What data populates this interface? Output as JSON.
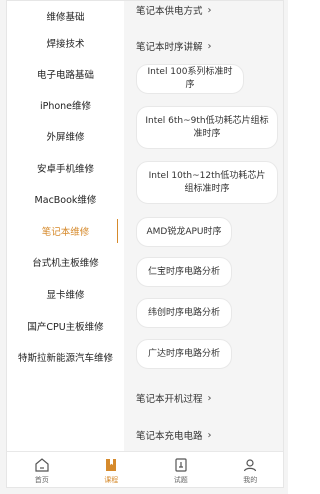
{
  "sidebar": {
    "items": [
      {
        "label": "维修基础"
      },
      {
        "label": "焊接技术"
      },
      {
        "label": "电子电路基础"
      },
      {
        "label": "iPhone维修"
      },
      {
        "label": "外屏维修"
      },
      {
        "label": "安卓手机维修"
      },
      {
        "label": "MacBook维修"
      },
      {
        "label": "笔记本维修"
      },
      {
        "label": "台式机主板维修"
      },
      {
        "label": "显卡维修"
      },
      {
        "label": "国产CPU主板维修"
      },
      {
        "label": "特斯拉新能源汽车维修"
      }
    ],
    "active_index": 7
  },
  "content": {
    "section_power": "笔记本供电方式",
    "section_timing": "笔记本时序讲解",
    "timing_items": [
      "Intel 100系列标准时序",
      "Intel 6th~9th低功耗芯片组标准时序",
      "Intel 10th~12th低功耗芯片组标准时序",
      "AMD锐龙APU时序",
      "仁宝时序电路分析",
      "纬创时序电路分析",
      "广达时序电路分析"
    ],
    "section_boot": "笔记本开机过程",
    "section_charge": "笔记本充电电路",
    "chevron": "›"
  },
  "tabbar": {
    "tabs": [
      {
        "label": "首页",
        "icon": "home-icon"
      },
      {
        "label": "课程",
        "icon": "course-bookmark-icon"
      },
      {
        "label": "试题",
        "icon": "exam-icon"
      },
      {
        "label": "我的",
        "icon": "profile-icon"
      }
    ],
    "active_index": 1
  },
  "colors": {
    "accent": "#d68a2c",
    "content_bg": "#f5f5f5"
  }
}
